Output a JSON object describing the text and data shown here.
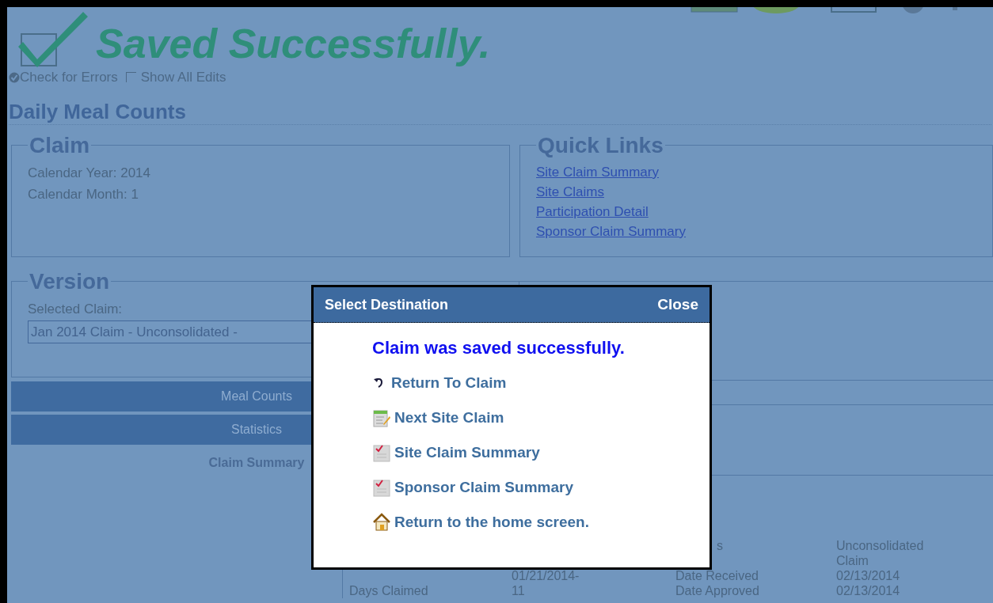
{
  "header": {
    "title": "Saved Successfully.",
    "checked": true
  },
  "options": [
    {
      "kind": "icon",
      "label": "Check for Errors"
    },
    {
      "kind": "checkbox",
      "label": "Show All Edits",
      "checked": false
    }
  ],
  "page_title": "Daily Meal Counts",
  "claim": {
    "legend": "Claim",
    "lines": [
      "Calendar Year: 2014",
      "Calendar Month: 1"
    ]
  },
  "quick_links": {
    "legend": "Quick Links",
    "links": [
      "Site Claim Summary",
      "Site Claims",
      "Participation Detail",
      "Sponsor Claim Summary"
    ]
  },
  "version": {
    "legend": "Version",
    "label": "Selected Claim:",
    "value": "Jan 2014 Claim - Unconsolidated -"
  },
  "nav": [
    {
      "label": "Meal Counts",
      "selected": false
    },
    {
      "label": "Statistics",
      "selected": false
    },
    {
      "label": "Claim Summary",
      "selected": true
    }
  ],
  "details": {
    "rows": [
      {
        "column_3": "s",
        "column_4": "Unconsolidated Claim"
      },
      {
        "column_2": "01/21/2014-",
        "column_3": "Date Received",
        "column_4": "02/13/2014"
      },
      {
        "column_1": "Days Claimed",
        "column_2": "11",
        "column_3": "Date Approved",
        "column_4": "02/13/2014"
      }
    ]
  },
  "dialog": {
    "title": "Select Destination",
    "close": "Close",
    "message": "Claim was saved successfully.",
    "items": [
      {
        "kind": "return",
        "label": "Return To Claim"
      },
      {
        "kind": "next",
        "label": "Next Site Claim"
      },
      {
        "kind": "summary",
        "label": "Site Claim Summary"
      },
      {
        "kind": "summary",
        "label": "Sponsor Claim Summary"
      },
      {
        "kind": "home",
        "label": "Return to the home screen."
      }
    ]
  }
}
